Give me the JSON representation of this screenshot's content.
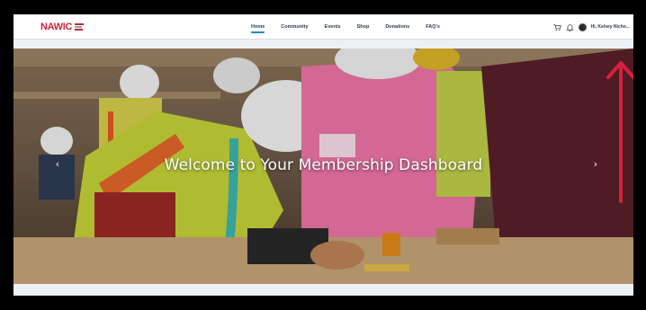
{
  "header": {
    "logo_text": "NAWIC",
    "nav": [
      {
        "label": "Home",
        "active": true
      },
      {
        "label": "Community",
        "active": false
      },
      {
        "label": "Events",
        "active": false
      },
      {
        "label": "Shop",
        "active": false
      },
      {
        "label": "Donations",
        "active": false
      },
      {
        "label": "FAQ's",
        "active": false
      }
    ],
    "greeting": "Hi, Kelsey Nicho..."
  },
  "hero": {
    "title": "Welcome to Your Membership Dashboard",
    "prev_icon": "chevron-left-icon",
    "next_icon": "chevron-right-icon"
  },
  "colors": {
    "accent": "#1e88c9",
    "annotation": "#d81f3c",
    "brand": "#c7273b"
  }
}
